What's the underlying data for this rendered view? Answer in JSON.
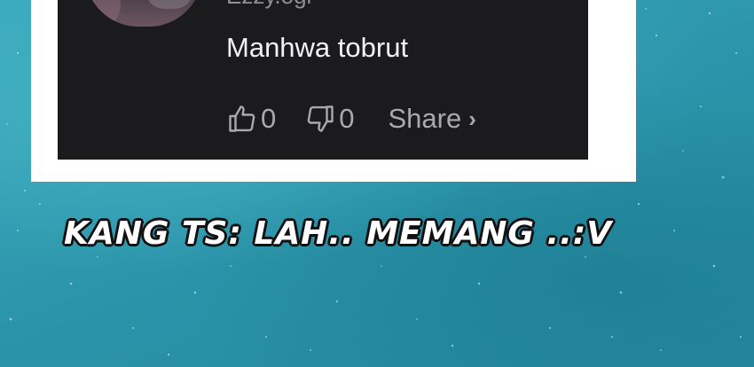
{
  "comment": {
    "author_partial": "Ezzy.ogi",
    "text": "Manhwa tobrut",
    "like_count": "0",
    "dislike_count": "0",
    "share_label": "Share",
    "share_chevron": "›"
  },
  "caption": {
    "text": "KANG TS: LAH.. MEMANG ..:V"
  },
  "icons": {
    "like": "thumbs-up-icon",
    "dislike": "thumbs-down-icon",
    "share": "chevron-right-icon"
  },
  "colors": {
    "background": "#2f9db2",
    "card": "#1b1a1d",
    "frame": "#ffffff",
    "comment_text": "#f2f2f2",
    "action_text": "#a9a9ae",
    "caption_fill": "#ffffff",
    "caption_stroke": "#111111"
  }
}
